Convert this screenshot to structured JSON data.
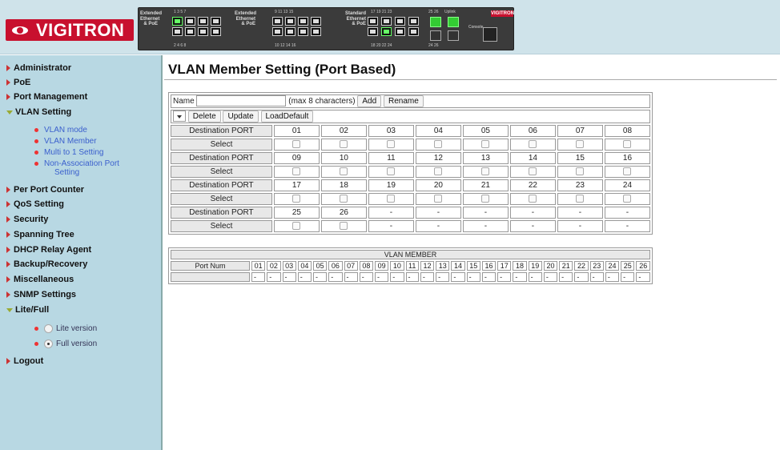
{
  "brand": {
    "logo_text": "VIGITRON",
    "panel_brand": "VIGITRON"
  },
  "device_panel": {
    "label_ext1": "Extended Ethernet & PoE",
    "label_ext2": "Extended Ethernet & PoE",
    "label_std": "Standard Ethernet & PoE",
    "uplink_label": "Uplink",
    "console_label": "Console",
    "top_nums_1": "1 3 5 7",
    "bottom_nums_1": "2 4 6 8",
    "top_nums_2": "9 11 13 15",
    "bottom_nums_2": "10 12 14 16",
    "top_nums_3": "17 19 21 23",
    "bottom_nums_3": "18 20 22 24",
    "sfp_top": "25 26",
    "sfp_bottom": "24 26"
  },
  "sidebar": {
    "items": [
      {
        "label": "Administrator"
      },
      {
        "label": "PoE"
      },
      {
        "label": "Port Management"
      },
      {
        "label": "VLAN Setting"
      },
      {
        "label": "Per Port Counter"
      },
      {
        "label": "QoS Setting"
      },
      {
        "label": "Security"
      },
      {
        "label": "Spanning Tree"
      },
      {
        "label": "DHCP Relay Agent"
      },
      {
        "label": "Backup/Recovery"
      },
      {
        "label": "Miscellaneous"
      },
      {
        "label": "SNMP Settings"
      },
      {
        "label": "Lite/Full"
      },
      {
        "label": "Logout"
      }
    ],
    "vlan_sub": [
      "VLAN mode",
      "VLAN Member",
      "Multi to 1 Setting",
      "Non-Association Port",
      "Setting"
    ],
    "lite_label": "Lite version",
    "full_label": "Full version"
  },
  "main": {
    "title": "VLAN Member Setting (Port Based)",
    "name_label": "Name",
    "name_value": "",
    "max_hint": "(max 8 characters)",
    "add_btn": "Add",
    "rename_btn": "Rename",
    "delete_btn": "Delete",
    "update_btn": "Update",
    "loaddefault_btn": "LoadDefault",
    "dest_label": "Destination PORT",
    "select_label": "Select",
    "port_rows": [
      [
        "01",
        "02",
        "03",
        "04",
        "05",
        "06",
        "07",
        "08"
      ],
      [
        "09",
        "10",
        "11",
        "12",
        "13",
        "14",
        "15",
        "16"
      ],
      [
        "17",
        "18",
        "19",
        "20",
        "21",
        "22",
        "23",
        "24"
      ],
      [
        "25",
        "26",
        "-",
        "-",
        "-",
        "-",
        "-",
        "-"
      ]
    ],
    "member_title": "VLAN MEMBER",
    "portnum_label": "Port Num",
    "member_ports": [
      "01",
      "02",
      "03",
      "04",
      "05",
      "06",
      "07",
      "08",
      "09",
      "10",
      "11",
      "12",
      "13",
      "14",
      "15",
      "16",
      "17",
      "18",
      "19",
      "20",
      "21",
      "22",
      "23",
      "24",
      "25",
      "26"
    ],
    "member_values": [
      "-",
      "-",
      "-",
      "-",
      "-",
      "-",
      "-",
      "-",
      "-",
      "-",
      "-",
      "-",
      "-",
      "-",
      "-",
      "-",
      "-",
      "-",
      "-",
      "-",
      "-",
      "-",
      "-",
      "-",
      "-",
      "-"
    ]
  },
  "colors": {
    "brand_red": "#c8102e",
    "sidebar_bg": "#b8d8e3",
    "header_bg": "#cfe3ea",
    "link_blue": "#3a5fcd"
  }
}
